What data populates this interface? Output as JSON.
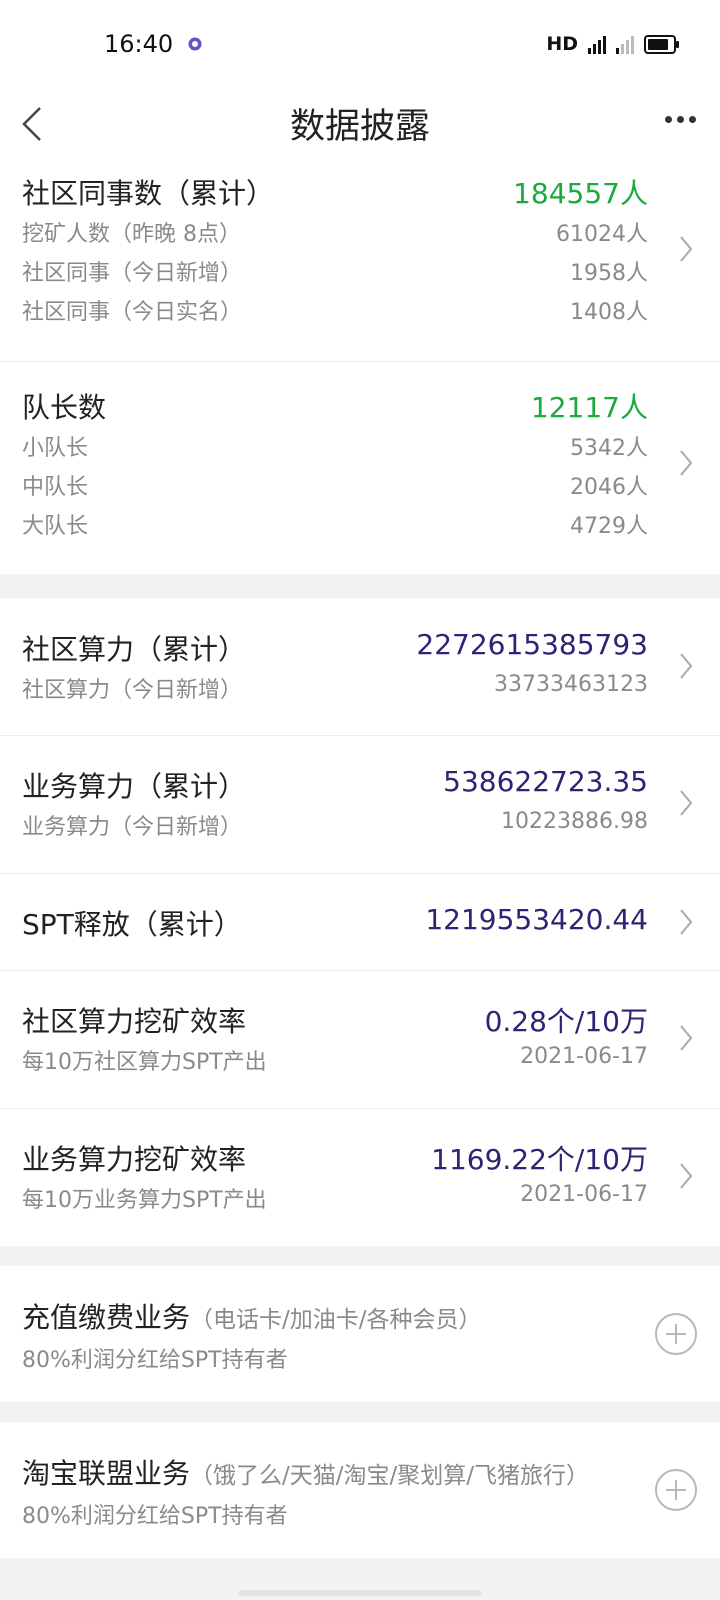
{
  "status": {
    "time": "16:40",
    "network": "HD"
  },
  "header": {
    "title": "数据披露"
  },
  "community_members": {
    "title": "社区同事数（累计）",
    "value": "184557人",
    "rows": [
      {
        "label": "挖矿人数（昨晚 8点）",
        "value": "61024人"
      },
      {
        "label": "社区同事（今日新增）",
        "value": "1958人"
      },
      {
        "label": "社区同事（今日实名）",
        "value": "1408人"
      }
    ]
  },
  "captains": {
    "title": "队长数",
    "value": "12117人",
    "rows": [
      {
        "label": "小队长",
        "value": "5342人"
      },
      {
        "label": "中队长",
        "value": "2046人"
      },
      {
        "label": "大队长",
        "value": "4729人"
      }
    ]
  },
  "community_power": {
    "title": "社区算力（累计）",
    "value": "2272615385793",
    "sub_label": "社区算力（今日新增）",
    "sub_value": "33733463123"
  },
  "business_power": {
    "title": "业务算力（累计）",
    "value": "538622723.35",
    "sub_label": "业务算力（今日新增）",
    "sub_value": "10223886.98"
  },
  "spt_release": {
    "title": "SPT释放（累计）",
    "value": "1219553420.44"
  },
  "community_efficiency": {
    "title": "社区算力挖矿效率",
    "value": "0.28个/10万",
    "sub_label": "每10万社区算力SPT产出",
    "date": "2021-06-17"
  },
  "business_efficiency": {
    "title": "业务算力挖矿效率",
    "value": "1169.22个/10万",
    "sub_label": "每10万业务算力SPT产出",
    "date": "2021-06-17"
  },
  "recharge": {
    "title": "充值缴费业务",
    "hint": "（电话卡/加油卡/各种会员）",
    "sub_label": "80%利润分红给SPT持有者"
  },
  "taobao": {
    "title": "淘宝联盟业务",
    "hint": "（饿了么/天猫/淘宝/聚划算/飞猪旅行）",
    "sub_label": "80%利润分红给SPT持有者"
  },
  "colors": {
    "green": "#1aaa3e",
    "blue": "#2c2475",
    "gray": "#8a8a8a"
  },
  "icons": [
    "back-icon",
    "more-icon",
    "chevron-right-icon",
    "plus-circle-icon",
    "battery-icon",
    "signal-icon"
  ]
}
